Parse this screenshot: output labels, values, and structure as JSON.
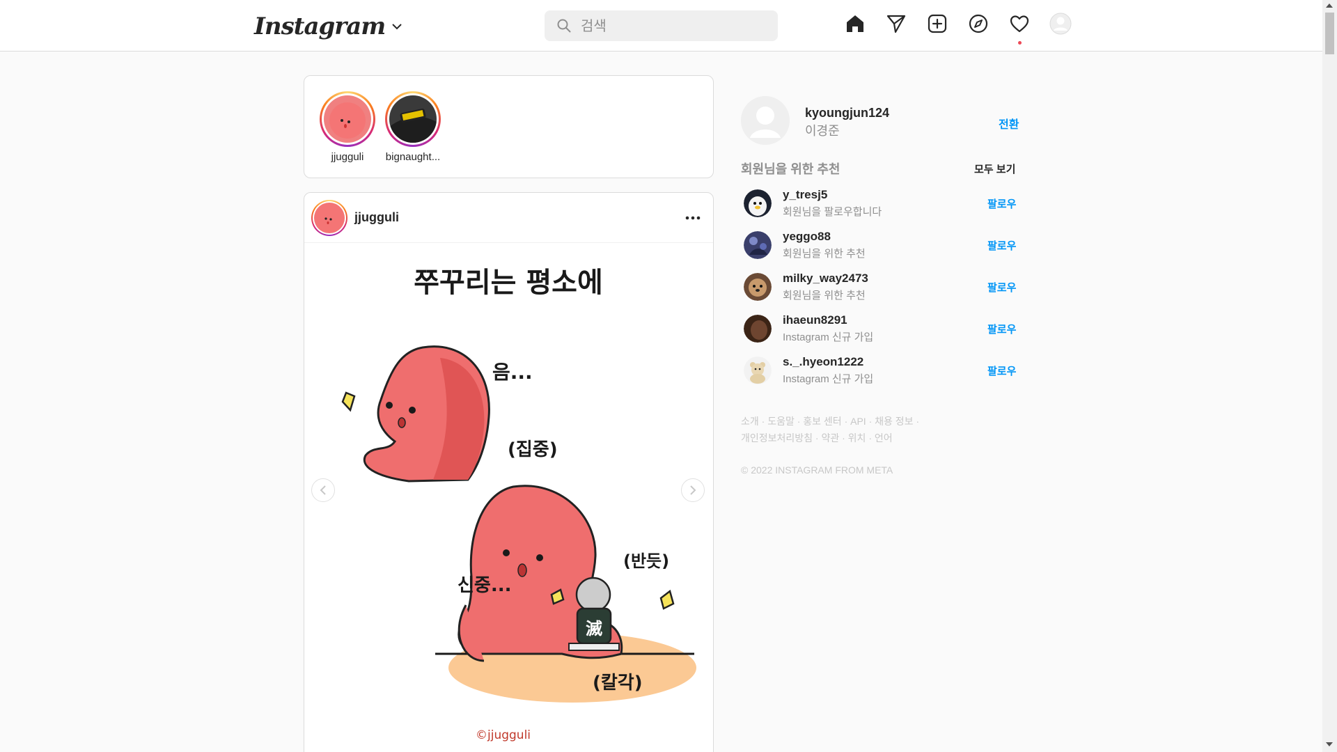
{
  "header": {
    "logo": "Instagram",
    "search_placeholder": "검색"
  },
  "stories": [
    {
      "name": "jjugguli"
    },
    {
      "name": "bignaught..."
    }
  ],
  "post": {
    "username": "jjugguli",
    "image": {
      "title": "쭈꾸리는 평소에",
      "text_hmm": "음...",
      "text_focus": "(집중)",
      "text_careful": "신중...",
      "text_shiny": "(반듯)",
      "text_click": "(칼각)",
      "patch": "滅",
      "watermark": "©jjugguli"
    }
  },
  "sidebar": {
    "username": "kyoungjun124",
    "name": "이경준",
    "switch_label": "전환",
    "recommend_title": "회원님을 위한 추천",
    "see_all": "모두 보기",
    "recommendations": [
      {
        "user": "y_tresj5",
        "sub": "회원님을 팔로우합니다",
        "follow": "팔로우"
      },
      {
        "user": "yeggo88",
        "sub": "회원님을 위한 추천",
        "follow": "팔로우"
      },
      {
        "user": "milky_way2473",
        "sub": "회원님을 위한 추천",
        "follow": "팔로우"
      },
      {
        "user": "ihaeun8291",
        "sub": "Instagram 신규 가입",
        "follow": "팔로우"
      },
      {
        "user": "s._.hyeon1222",
        "sub": "Instagram 신규 가입",
        "follow": "팔로우"
      }
    ],
    "footer_line1": "소개 · 도움말 · 홍보 센터 · API · 채용 정보 ·",
    "footer_line2": "개인정보처리방침 · 약관 · 위치 · 언어",
    "copyright": "© 2022 INSTAGRAM FROM META"
  }
}
